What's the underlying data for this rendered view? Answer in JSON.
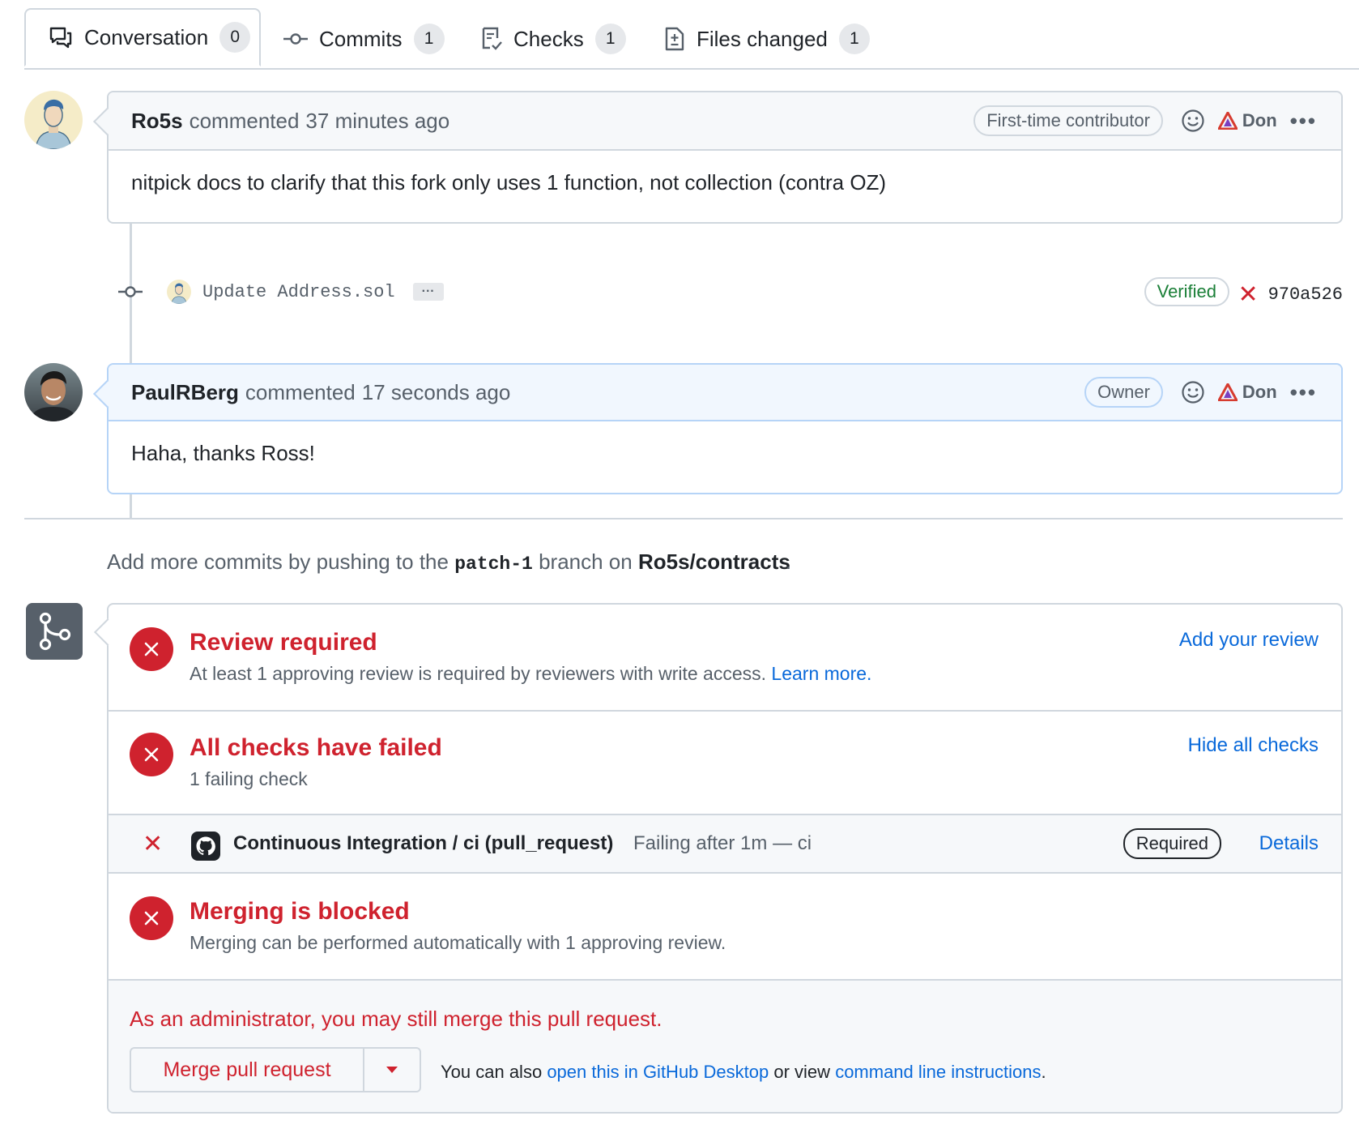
{
  "tabs": [
    {
      "label": "Conversation",
      "count": "0"
    },
    {
      "label": "Commits",
      "count": "1"
    },
    {
      "label": "Checks",
      "count": "1"
    },
    {
      "label": "Files changed",
      "count": "1"
    }
  ],
  "comments": [
    {
      "author": "Ro5s",
      "action": "commented",
      "time": "37 minutes ago",
      "role": "First-time contributor",
      "extension": "Don",
      "body": "nitpick docs to clarify that this fork only uses 1 function, not collection (contra OZ)"
    },
    {
      "author": "PaulRBerg",
      "action": "commented",
      "time": "17 seconds ago",
      "role": "Owner",
      "extension": "Don",
      "body": "Haha, thanks Ross!"
    }
  ],
  "commit": {
    "message": "Update Address.sol",
    "ellipsis": "···",
    "verified": "Verified",
    "sha": "970a526",
    "status_icon": "✕"
  },
  "push_hint": {
    "prefix": "Add more commits by pushing to the",
    "branch": "patch-1",
    "middle": "branch on",
    "repo": "Ro5s/contracts",
    "suffix": "."
  },
  "merge_box": {
    "review": {
      "title": "Review required",
      "subtitle": "At least 1 approving review is required by reviewers with write access.",
      "learn_more": "Learn more.",
      "action": "Add your review"
    },
    "checks": {
      "title": "All checks have failed",
      "subtitle": "1 failing check",
      "action": "Hide all checks"
    },
    "check_item": {
      "status_icon": "✕",
      "name": "Continuous Integration / ci (pull_request)",
      "description": "Failing after 1m — ci",
      "badge": "Required",
      "details": "Details"
    },
    "blocked": {
      "title": "Merging is blocked",
      "subtitle": "Merging can be performed automatically with 1 approving review."
    },
    "admin": {
      "notice": "As an administrator, you may still merge this pull request.",
      "merge_button": "Merge pull request",
      "also_prefix": "You can also",
      "desktop_link": "open this in GitHub Desktop",
      "or_view": "or view",
      "cli_link": "command line instructions",
      "suffix": "."
    }
  },
  "colors": {
    "danger": "#cf222e",
    "link": "#0969da",
    "success": "#1a7f37",
    "border": "#d0d7de"
  }
}
